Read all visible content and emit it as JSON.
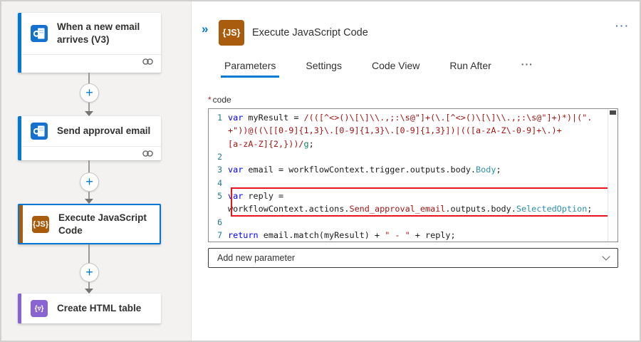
{
  "canvas": {
    "cards": [
      {
        "title": "When a new email arrives (V3)",
        "icon": "outlook",
        "accent": "#0078d4",
        "has_connection_footer": true,
        "selected": false
      },
      {
        "title": "Send approval email",
        "icon": "outlook",
        "accent": "#0078d4",
        "has_connection_footer": true,
        "selected": false
      },
      {
        "title": "Execute JavaScript Code",
        "icon": "javascript-code",
        "icon_glyph": "{JS}",
        "accent": "#a95c0d",
        "has_connection_footer": false,
        "selected": true
      },
      {
        "title": "Create HTML table",
        "icon": "data-operation",
        "icon_glyph": "{▿}",
        "accent": "#8a63d2",
        "has_connection_footer": false,
        "selected": false
      }
    ],
    "add_step_glyph": "+"
  },
  "panel": {
    "collapse_glyph": "»",
    "icon_glyph": "{JS}",
    "title": "Execute JavaScript Code",
    "menu_glyph": "···",
    "tabs": [
      {
        "label": "Parameters",
        "active": true
      },
      {
        "label": "Settings",
        "active": false
      },
      {
        "label": "Code View",
        "active": false
      },
      {
        "label": "Run After",
        "active": false
      },
      {
        "label": "···",
        "active": false,
        "overflow": true
      }
    ],
    "field": {
      "required_marker": "*",
      "label": "code"
    },
    "add_parameter_label": "Add new parameter"
  },
  "colors": {
    "accent_blue": "#0078d4",
    "js_orange": "#a95c0d",
    "dataop_purple": "#8a63d2",
    "highlight_red": "#e8131d",
    "syntax_keyword": "#0101fd",
    "syntax_regex": "#a31515",
    "syntax_type": "#2b91af",
    "syntax_flag": "#098658",
    "line_number": "#237893"
  },
  "code_editor": {
    "rows": [
      {
        "num": "1",
        "segments": [
          {
            "t": "var ",
            "c": "kw"
          },
          {
            "t": "myResult = ",
            "c": "pl"
          },
          {
            "t": "/(([^<>()\\[\\]\\\\.,;:\\s@\"]+(\\.[^<>()\\[\\]\\\\.,;:\\s@\"]+)*)|(\".",
            "c": "rx"
          }
        ]
      },
      {
        "num": "",
        "segments": [
          {
            "t": "+\"))@((\\[[0-9]{1,3}\\.[0-9]{1,3}\\.[0-9]{1,3}])|(([a-zA-Z\\-0-9]+\\.)+",
            "c": "rx"
          }
        ]
      },
      {
        "num": "",
        "segments": [
          {
            "t": "[a-zA-Z]{2,}))/",
            "c": "rx"
          },
          {
            "t": "g",
            "c": "fl"
          },
          {
            "t": ";",
            "c": "pl"
          }
        ]
      },
      {
        "num": "2",
        "segments": []
      },
      {
        "num": "3",
        "segments": [
          {
            "t": "var ",
            "c": "kw"
          },
          {
            "t": "email = workflowContext.trigger.outputs.body.",
            "c": "pl"
          },
          {
            "t": "Body",
            "c": "ty"
          },
          {
            "t": ";",
            "c": "pl"
          }
        ]
      },
      {
        "num": "4",
        "segments": []
      },
      {
        "num": "5",
        "highlighted": true,
        "segments": [
          {
            "t": "var ",
            "c": "kw"
          },
          {
            "t": "reply =",
            "c": "pl"
          }
        ]
      },
      {
        "num": "",
        "highlighted": true,
        "segments": [
          {
            "t": "workflowContext.actions.",
            "c": "pl"
          },
          {
            "t": "Send_approval_email",
            "c": "rx"
          },
          {
            "t": ".outputs.body.",
            "c": "pl"
          },
          {
            "t": "SelectedOption",
            "c": "ty"
          },
          {
            "t": ";",
            "c": "pl"
          }
        ]
      },
      {
        "num": "6",
        "segments": []
      },
      {
        "num": "7",
        "segments": [
          {
            "t": "return ",
            "c": "kw"
          },
          {
            "t": "email.match(myResult) + ",
            "c": "pl"
          },
          {
            "t": "\" - \"",
            "c": "rx"
          },
          {
            "t": " + reply;",
            "c": "pl"
          }
        ]
      }
    ]
  }
}
